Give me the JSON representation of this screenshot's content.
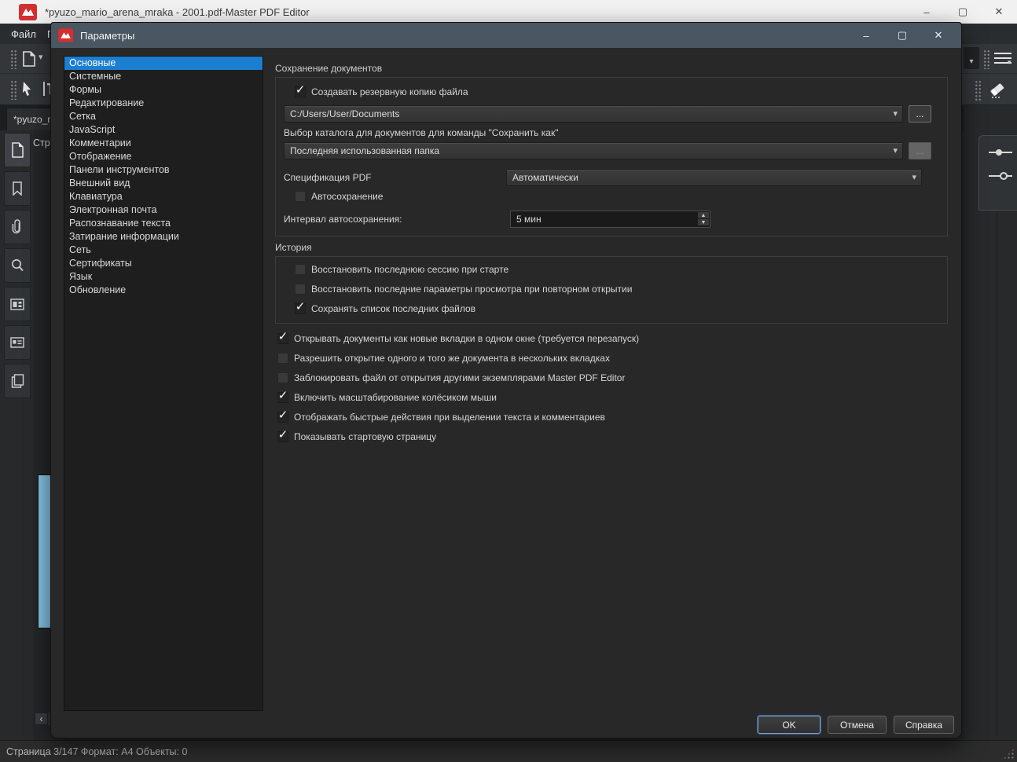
{
  "icons": {
    "minimize": "–",
    "maximize": "▢",
    "close": "✕",
    "dropdown": "▾",
    "chevron_left": "‹",
    "ellipsis": "...",
    "check": "✓",
    "spin_up": "▲",
    "spin_down": "▼"
  },
  "window": {
    "title": "*pyuzo_mario_arena_mraka - 2001.pdf-Master PDF Editor",
    "menu": {
      "file": "Файл",
      "edit_partial": "Пр"
    },
    "doc_tab": "*pyuzo_ma",
    "pages_panel_title": "Стра",
    "status_text": "Страница 3/147 Формат: A4 Объекты: 0"
  },
  "dialog": {
    "title": "Параметры",
    "categories": [
      "Основные",
      "Системные",
      "Формы",
      "Редактирование",
      "Сетка",
      "JavaScript",
      "Комментарии",
      "Отображение",
      "Панели инструментов",
      "Внешний вид",
      "Клавиатура",
      "Электронная почта",
      "Распознавание текста",
      "Затирание информации",
      "Сеть",
      "Сертификаты",
      "Язык",
      "Обновление"
    ],
    "save_group": {
      "title": "Сохранение документов",
      "backup": {
        "label": "Создавать резервную копию файла",
        "checked": true
      },
      "backup_path": "C:/Users/User/Documents",
      "saveas_label": "Выбор каталога для документов для команды \"Сохранить как\"",
      "saveas_value": "Последняя использованная папка",
      "spec_label": "Спецификация PDF",
      "spec_value": "Автоматически",
      "autosave": {
        "label": "Автосохранение",
        "checked": false
      },
      "interval_label": "Интервал автосохранения:",
      "interval_value": "5 мин"
    },
    "history_group": {
      "title": "История",
      "items": [
        {
          "label": "Восстановить последнюю сессию при старте",
          "checked": false
        },
        {
          "label": "Восстановить последние параметры просмотра при повторном открытии",
          "checked": false
        },
        {
          "label": "Сохранять список последних файлов",
          "checked": true
        }
      ]
    },
    "options": [
      {
        "label": "Открывать документы как новые вкладки в одном окне (требуется перезапуск)",
        "checked": true
      },
      {
        "label": "Разрешить открытие одного и того же документа в нескольких вкладках",
        "checked": false
      },
      {
        "label": "Заблокировать файл от открытия другими экземплярами Master PDF Editor",
        "checked": false
      },
      {
        "label": "Включить масштабирование колёсиком мыши",
        "checked": true
      },
      {
        "label": "Отображать быстрые действия при выделении текста и комментариев",
        "checked": true
      },
      {
        "label": "Показывать стартовую страницу",
        "checked": true
      }
    ],
    "buttons": {
      "ok": "OK",
      "cancel": "Отмена",
      "help": "Справка"
    }
  },
  "colors": {
    "selection_blue": "#1c7ed0",
    "dialog_titlebar": "#4a5661",
    "brand_red": "#d32f2f",
    "thumbnail_blue": "#85c3e3"
  }
}
